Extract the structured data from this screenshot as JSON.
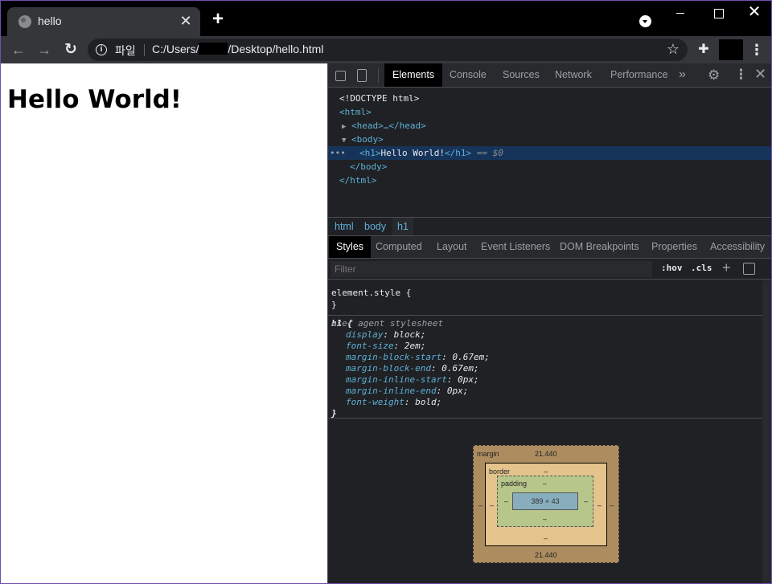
{
  "browser": {
    "tab_title": "hello",
    "new_tab": "+",
    "tab_close": "✕",
    "window_close": "✕",
    "omnibox_chip": "파일",
    "url_prefix": "C:/Users/",
    "url_suffix": "/Desktop/hello.html",
    "bookmark_star": "☆",
    "back": "←",
    "forward": "→",
    "reload": "↻",
    "extensions": "✚",
    "menu": "⋮"
  },
  "page": {
    "heading": "Hello World!"
  },
  "devtools": {
    "tabs": [
      "Elements",
      "Console",
      "Sources",
      "Network",
      "Performance"
    ],
    "active_tab": "Elements",
    "more": "»",
    "gear": "⚙",
    "kebab": "⋮",
    "close": "✕",
    "dom": {
      "doctype": "<!DOCTYPE html>",
      "html_open": "<html>",
      "head": "<head>…</head>",
      "body_open": "<body>",
      "h1_open": "<h1>",
      "h1_text": "Hello World!",
      "h1_close": "</h1>",
      "selected_marker": "== $0",
      "body_close": "</body>",
      "html_close": "</html>",
      "dots": "•••"
    },
    "breadcrumbs": [
      "html",
      "body",
      "h1"
    ],
    "subtabs": [
      "Styles",
      "Computed",
      "Layout",
      "Event Listeners",
      "DOM Breakpoints",
      "Properties",
      "Accessibility"
    ],
    "filter_placeholder": "Filter",
    "hov": ":hov",
    "cls": ".cls",
    "plus": "+",
    "element_style": "element.style {",
    "close_brace": "}",
    "h1_rule_selector": "h1 {",
    "ua_label": "user agent stylesheet",
    "h1_rules": [
      {
        "prop": "display",
        "val": "block;"
      },
      {
        "prop": "font-size",
        "val": "2em;"
      },
      {
        "prop": "margin-block-start",
        "val": "0.67em;"
      },
      {
        "prop": "margin-block-end",
        "val": "0.67em;"
      },
      {
        "prop": "margin-inline-start",
        "val": "0px;"
      },
      {
        "prop": "margin-inline-end",
        "val": "0px;"
      },
      {
        "prop": "font-weight",
        "val": "bold;"
      }
    ],
    "box_model": {
      "margin_label": "margin",
      "margin_top": "21.440",
      "margin_bottom": "21.440",
      "margin_left": "–",
      "margin_right": "–",
      "border_label": "border",
      "border_top": "–",
      "border_bottom": "–",
      "border_left": "–",
      "border_right": "–",
      "padding_label": "padding",
      "padding_top": "–",
      "padding_bottom": "–",
      "padding_left": "–",
      "padding_right": "–",
      "content": "389 × 43"
    }
  }
}
